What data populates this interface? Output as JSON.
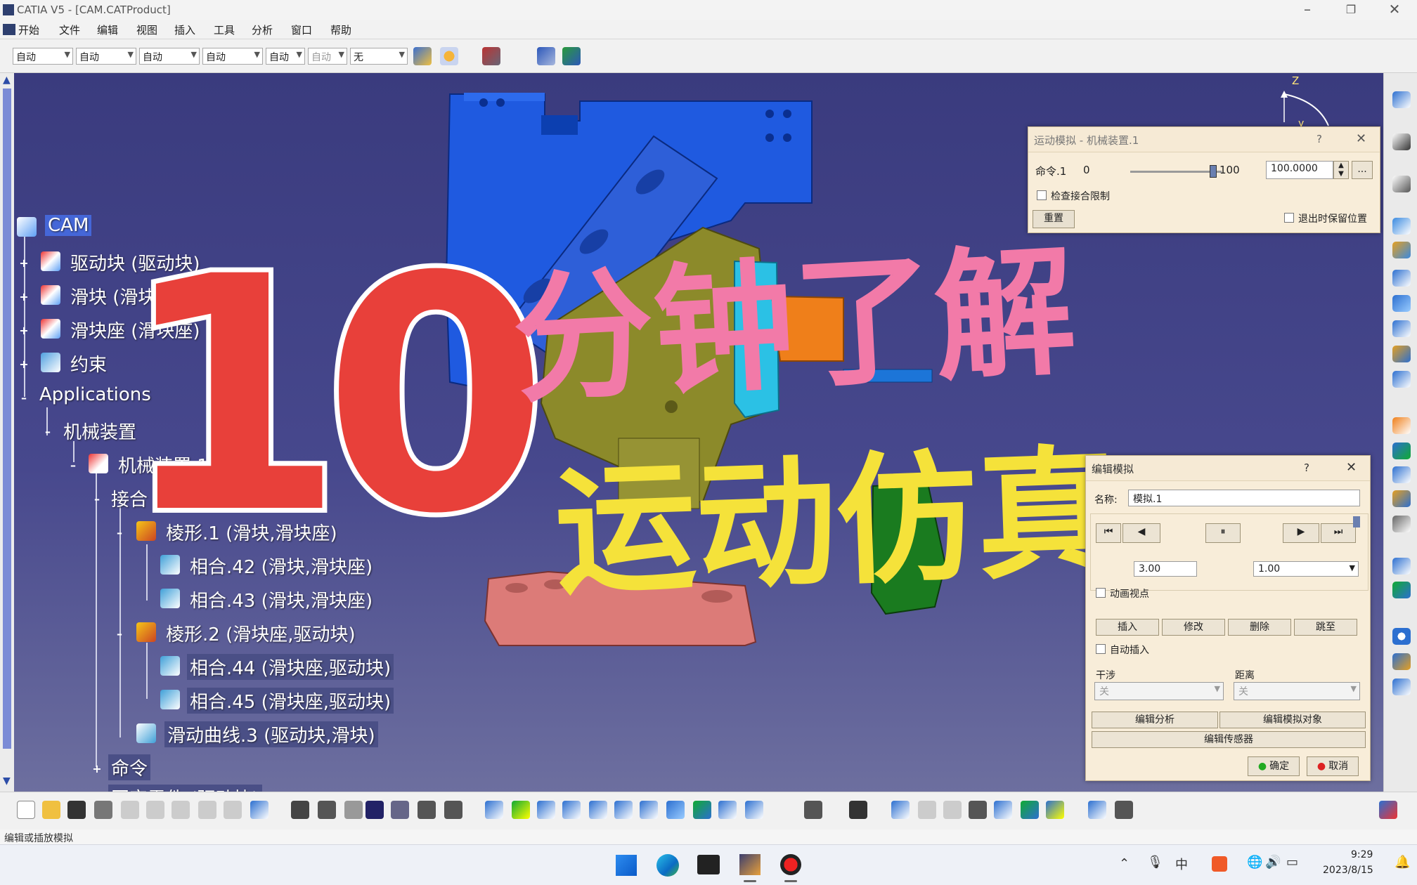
{
  "window": {
    "title": "CATIA V5 - [CAM.CATProduct]",
    "min": "–",
    "max": "❐",
    "close": "✕"
  },
  "menu": [
    "开始",
    "文件",
    "编辑",
    "视图",
    "插入",
    "工具",
    "分析",
    "窗口",
    "帮助"
  ],
  "toolbar_combos": [
    "自动",
    "自动",
    "自动",
    "自动",
    "自动",
    "自动",
    "无"
  ],
  "tree": {
    "root": "CAM",
    "items": [
      "驱动块 (驱动块)",
      "滑块 (滑块)",
      "滑块座 (滑块座)",
      "约束",
      "Applications",
      "机械装置",
      "机械装置.1",
      "接合",
      "棱形.1 (滑块,滑块座)",
      "相合.42 (滑块,滑块座)",
      "相合.43 (滑块,滑块座)",
      "棱形.2 (滑块座,驱动块)",
      "相合.44 (滑块座,驱动块)",
      "相合.45 (滑块座,驱动块)",
      "滑动曲线.3 (驱动块,滑块)",
      "命令",
      "固定零件 (驱动块)"
    ]
  },
  "overlay": {
    "number": "10",
    "line1": "分钟了解",
    "line2": "运动仿真"
  },
  "motion_dialog": {
    "title": "运动模拟 - 机械装置.1",
    "help": "?",
    "cmd_label": "命令.1",
    "min": "0",
    "max": "100",
    "value": "100.0000",
    "more": "...",
    "check_limits": "检查接合限制",
    "reset": "重置",
    "keep_position": "退出时保留位置"
  },
  "edit_dialog": {
    "title": "编辑模拟",
    "help": "?",
    "name_label": "名称:",
    "name_value": "模拟.1",
    "step_value": "3.00",
    "step_value2": "1.00",
    "animate_viewpoint": "动画视点",
    "buttons": [
      "插入",
      "修改",
      "删除",
      "跳至"
    ],
    "auto_insert": "自动插入",
    "interference_label": "干涉",
    "interference_value": "关",
    "distance_label": "距离",
    "distance_value": "关",
    "edit_analysis": "编辑分析",
    "edit_sim_objects": "编辑模拟对象",
    "edit_sensors": "编辑传感器",
    "ok": "确定",
    "cancel": "取消"
  },
  "compass": {
    "z": "Z",
    "y": "y"
  },
  "statusbar": "编辑或插放模拟",
  "taskbar": {
    "time": "9:29",
    "date": "2023/8/15"
  },
  "colors": {
    "overlay_red": "#e8403a",
    "overlay_pink": "#f27aa8",
    "overlay_yellow": "#f5e23a",
    "selection": "#4567d8"
  }
}
